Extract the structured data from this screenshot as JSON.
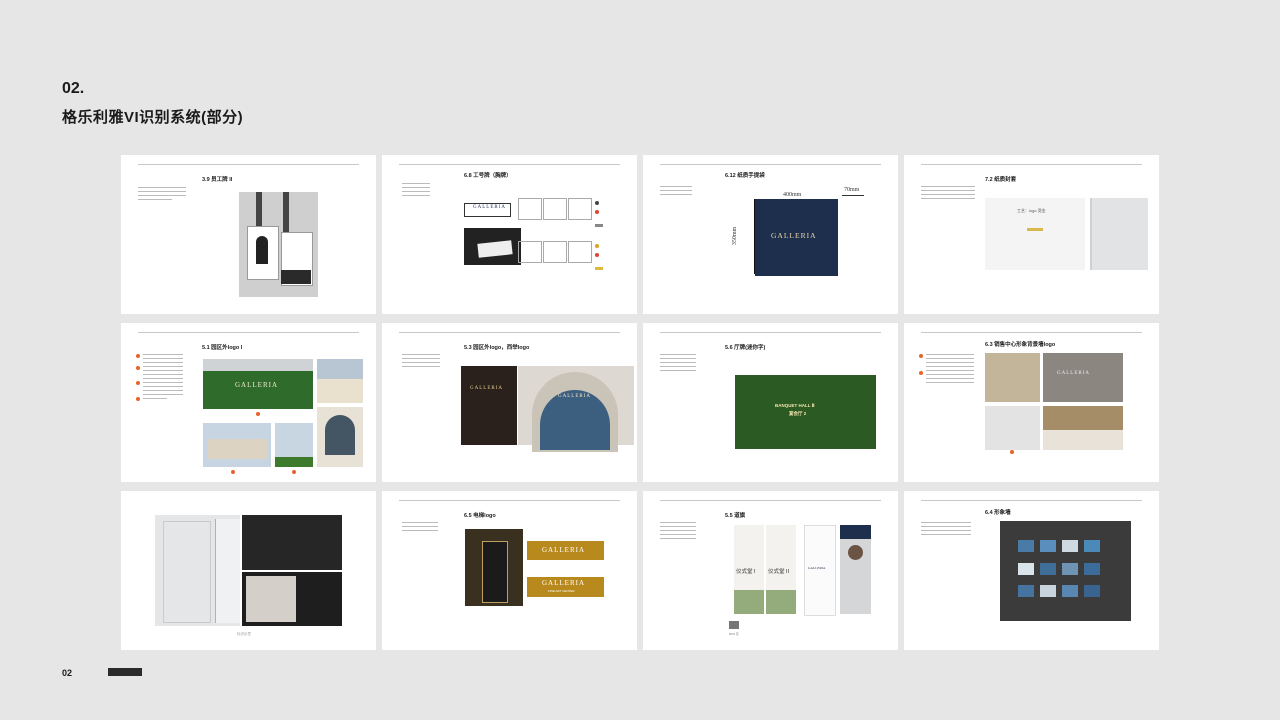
{
  "header": {
    "section_number": "02.",
    "title": "格乐利雅VI识别系统(部分)"
  },
  "footer": {
    "page_number": "02"
  },
  "cards": [
    {
      "title": "3.9 员工牌 II"
    },
    {
      "title": "6.8 工号牌（胸牌）",
      "brand": "GALLERIA"
    },
    {
      "title": "6.12 纸质手提袋",
      "brand": "GALLERIA",
      "dim_width": "400mm",
      "dim_depth": "70mm",
      "dim_height": "350mm"
    },
    {
      "title": "7.2 纸质封套",
      "text": "工艺：logo 烫金"
    },
    {
      "title": "5.1 园区外logo I",
      "sign": "GALLERIA"
    },
    {
      "title": "5.3 园区外logo，西举logo",
      "sign": "GALLERIA"
    },
    {
      "title": "5.6 厅牌(迷你字)",
      "sign_line1": "BANQUET HALL Ⅱ",
      "sign_line2": "宴会厅 2"
    },
    {
      "title": "6.3 销售中心形象背景墙logo",
      "sign": "GALLERIA"
    },
    {
      "caption": "标识示意"
    },
    {
      "title": "6.5 电梯logo",
      "brand1": "GALLERIA",
      "brand2": "GALLERIA",
      "brand2_sub": "FINE ART CENTER"
    },
    {
      "title": "5.5 道旗",
      "banner_text1": "仪式堂 I",
      "banner_text2": "仪式堂 II",
      "brand": "GALLERIA",
      "swatch_label": "50% 灰"
    },
    {
      "title": "6.4 形象墙"
    }
  ],
  "colors": {
    "bg": "#e6e6e6",
    "navy": "#1d2f4d",
    "gold": "#b88a1e",
    "orange": "#e8632a",
    "green": "#2f6b2a"
  }
}
